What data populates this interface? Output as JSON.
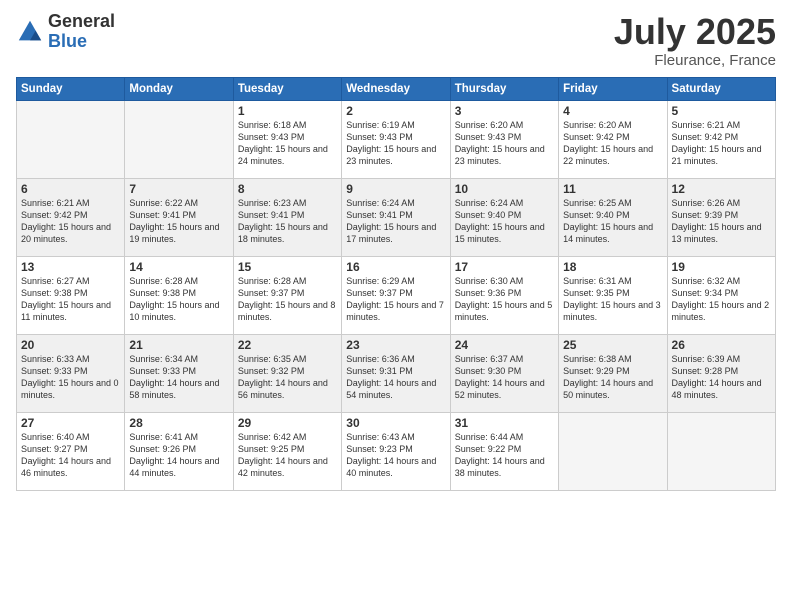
{
  "logo": {
    "general": "General",
    "blue": "Blue"
  },
  "title": "July 2025",
  "location": "Fleurance, France",
  "weekdays": [
    "Sunday",
    "Monday",
    "Tuesday",
    "Wednesday",
    "Thursday",
    "Friday",
    "Saturday"
  ],
  "weeks": [
    [
      {
        "day": "",
        "empty": true
      },
      {
        "day": "",
        "empty": true
      },
      {
        "day": "1",
        "sunrise": "6:18 AM",
        "sunset": "9:43 PM",
        "daylight": "15 hours and 24 minutes."
      },
      {
        "day": "2",
        "sunrise": "6:19 AM",
        "sunset": "9:43 PM",
        "daylight": "15 hours and 23 minutes."
      },
      {
        "day": "3",
        "sunrise": "6:20 AM",
        "sunset": "9:43 PM",
        "daylight": "15 hours and 23 minutes."
      },
      {
        "day": "4",
        "sunrise": "6:20 AM",
        "sunset": "9:42 PM",
        "daylight": "15 hours and 22 minutes."
      },
      {
        "day": "5",
        "sunrise": "6:21 AM",
        "sunset": "9:42 PM",
        "daylight": "15 hours and 21 minutes."
      }
    ],
    [
      {
        "day": "6",
        "sunrise": "6:21 AM",
        "sunset": "9:42 PM",
        "daylight": "15 hours and 20 minutes."
      },
      {
        "day": "7",
        "sunrise": "6:22 AM",
        "sunset": "9:41 PM",
        "daylight": "15 hours and 19 minutes."
      },
      {
        "day": "8",
        "sunrise": "6:23 AM",
        "sunset": "9:41 PM",
        "daylight": "15 hours and 18 minutes."
      },
      {
        "day": "9",
        "sunrise": "6:24 AM",
        "sunset": "9:41 PM",
        "daylight": "15 hours and 17 minutes."
      },
      {
        "day": "10",
        "sunrise": "6:24 AM",
        "sunset": "9:40 PM",
        "daylight": "15 hours and 15 minutes."
      },
      {
        "day": "11",
        "sunrise": "6:25 AM",
        "sunset": "9:40 PM",
        "daylight": "15 hours and 14 minutes."
      },
      {
        "day": "12",
        "sunrise": "6:26 AM",
        "sunset": "9:39 PM",
        "daylight": "15 hours and 13 minutes."
      }
    ],
    [
      {
        "day": "13",
        "sunrise": "6:27 AM",
        "sunset": "9:38 PM",
        "daylight": "15 hours and 11 minutes."
      },
      {
        "day": "14",
        "sunrise": "6:28 AM",
        "sunset": "9:38 PM",
        "daylight": "15 hours and 10 minutes."
      },
      {
        "day": "15",
        "sunrise": "6:28 AM",
        "sunset": "9:37 PM",
        "daylight": "15 hours and 8 minutes."
      },
      {
        "day": "16",
        "sunrise": "6:29 AM",
        "sunset": "9:37 PM",
        "daylight": "15 hours and 7 minutes."
      },
      {
        "day": "17",
        "sunrise": "6:30 AM",
        "sunset": "9:36 PM",
        "daylight": "15 hours and 5 minutes."
      },
      {
        "day": "18",
        "sunrise": "6:31 AM",
        "sunset": "9:35 PM",
        "daylight": "15 hours and 3 minutes."
      },
      {
        "day": "19",
        "sunrise": "6:32 AM",
        "sunset": "9:34 PM",
        "daylight": "15 hours and 2 minutes."
      }
    ],
    [
      {
        "day": "20",
        "sunrise": "6:33 AM",
        "sunset": "9:33 PM",
        "daylight": "15 hours and 0 minutes."
      },
      {
        "day": "21",
        "sunrise": "6:34 AM",
        "sunset": "9:33 PM",
        "daylight": "14 hours and 58 minutes."
      },
      {
        "day": "22",
        "sunrise": "6:35 AM",
        "sunset": "9:32 PM",
        "daylight": "14 hours and 56 minutes."
      },
      {
        "day": "23",
        "sunrise": "6:36 AM",
        "sunset": "9:31 PM",
        "daylight": "14 hours and 54 minutes."
      },
      {
        "day": "24",
        "sunrise": "6:37 AM",
        "sunset": "9:30 PM",
        "daylight": "14 hours and 52 minutes."
      },
      {
        "day": "25",
        "sunrise": "6:38 AM",
        "sunset": "9:29 PM",
        "daylight": "14 hours and 50 minutes."
      },
      {
        "day": "26",
        "sunrise": "6:39 AM",
        "sunset": "9:28 PM",
        "daylight": "14 hours and 48 minutes."
      }
    ],
    [
      {
        "day": "27",
        "sunrise": "6:40 AM",
        "sunset": "9:27 PM",
        "daylight": "14 hours and 46 minutes."
      },
      {
        "day": "28",
        "sunrise": "6:41 AM",
        "sunset": "9:26 PM",
        "daylight": "14 hours and 44 minutes."
      },
      {
        "day": "29",
        "sunrise": "6:42 AM",
        "sunset": "9:25 PM",
        "daylight": "14 hours and 42 minutes."
      },
      {
        "day": "30",
        "sunrise": "6:43 AM",
        "sunset": "9:23 PM",
        "daylight": "14 hours and 40 minutes."
      },
      {
        "day": "31",
        "sunrise": "6:44 AM",
        "sunset": "9:22 PM",
        "daylight": "14 hours and 38 minutes."
      },
      {
        "day": "",
        "empty": true
      },
      {
        "day": "",
        "empty": true
      }
    ]
  ]
}
